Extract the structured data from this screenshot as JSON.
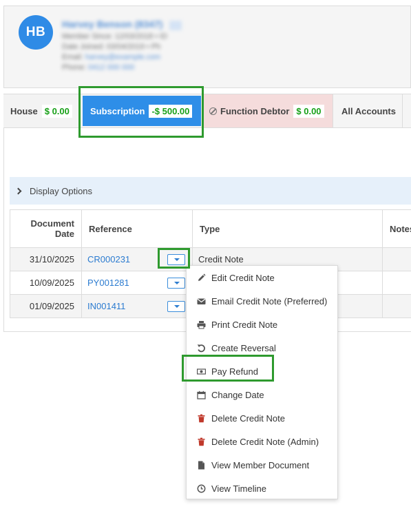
{
  "profile": {
    "initials": "HB",
    "name": "Harvey Benson (8347)",
    "info_lines": [
      "Member Since:  12/03/2018 • ID",
      "Date Joined:  03/04/2019 • Ph",
      "Email: ",
      "Phone: "
    ],
    "email": "harvey@example.com",
    "phone": "0412 000 000"
  },
  "tabs": {
    "house": {
      "label": "House",
      "amount": "$ 0.00"
    },
    "subscription": {
      "label": "Subscription",
      "amount": "-$ 500.00"
    },
    "function_debtor": {
      "label": "Function Debtor",
      "amount": "$ 0.00"
    },
    "all_accounts": {
      "label": "All Accounts"
    }
  },
  "display_options": {
    "label": "Display Options"
  },
  "table": {
    "headers": {
      "date": "Document Date",
      "reference": "Reference",
      "type": "Type",
      "notes": "Notes"
    },
    "rows": [
      {
        "date": "31/10/2025",
        "reference": "CR000231",
        "type": "Credit Note"
      },
      {
        "date": "10/09/2025",
        "reference": "PY001281",
        "type": ""
      },
      {
        "date": "01/09/2025",
        "reference": "IN001411",
        "type": ""
      }
    ]
  },
  "menu": {
    "items": [
      {
        "label": "Edit Credit Note",
        "icon": "pencil-icon"
      },
      {
        "label": "Email Credit Note (Preferred)",
        "icon": "envelope-icon"
      },
      {
        "label": "Print Credit Note",
        "icon": "printer-icon"
      },
      {
        "label": "Create Reversal",
        "icon": "undo-icon"
      },
      {
        "label": "Pay Refund",
        "icon": "money-icon"
      },
      {
        "label": "Change Date",
        "icon": "calendar-icon"
      },
      {
        "label": "Delete Credit Note",
        "icon": "trash-icon"
      },
      {
        "label": "Delete Credit Note (Admin)",
        "icon": "trash-icon"
      },
      {
        "label": "View Member Document",
        "icon": "document-icon"
      },
      {
        "label": "View Timeline",
        "icon": "clock-icon"
      }
    ]
  },
  "colors": {
    "accent": "#2e8ee8",
    "positive_amount": "#18a018",
    "highlight": "#2e9a2e",
    "delete_icon": "#c0392b",
    "function_tab_bg": "#f5dcdc"
  }
}
